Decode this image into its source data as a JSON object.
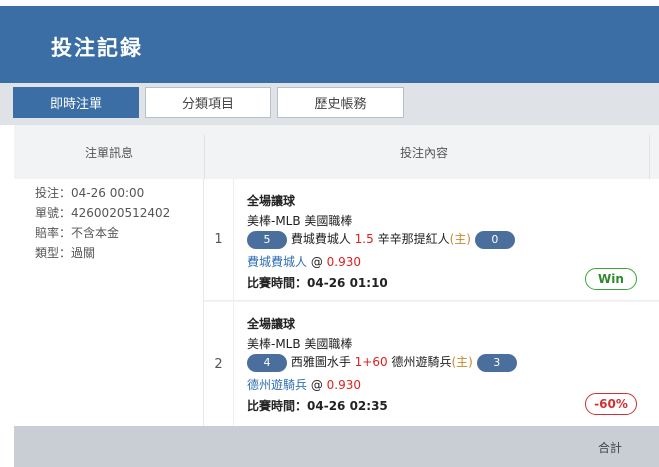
{
  "header": {
    "title": "投注記録"
  },
  "tabs": [
    {
      "label": "即時注單",
      "active": true
    },
    {
      "label": "分類項目",
      "active": false
    },
    {
      "label": "歷史帳務",
      "active": false
    }
  ],
  "table": {
    "col_info": "注單訊息",
    "col_content": "投注內容"
  },
  "bet_info": {
    "time_label": "投注：",
    "time_value": "04-26 00:00",
    "id_label": "單號：",
    "id_value": "4260020512402",
    "odds_label": "賠率：",
    "odds_value": "不含本金",
    "type_label": "類型：",
    "type_value": "過關"
  },
  "rows": [
    {
      "num": "1",
      "market": "全場讓球",
      "league": "美棒-MLB 美國職棒",
      "home_score": "5",
      "home_team": "費城費城人",
      "handicap": "1.5",
      "away_team": "辛辛那提紅人",
      "home_tag": "(主)",
      "away_score": "0",
      "pick": "費城費城人",
      "at": "@",
      "odds": "0.930",
      "match_time_label": "比賽時間：",
      "match_time": "04-26 01:10",
      "result": "Win"
    },
    {
      "num": "2",
      "market": "全場讓球",
      "league": "美棒-MLB 美國職棒",
      "home_score": "4",
      "home_team": "西雅圖水手",
      "handicap": "1+60",
      "away_team": "德州遊騎兵",
      "home_tag": "(主)",
      "away_score": "3",
      "pick": "德州遊騎兵",
      "at": "@",
      "odds": "0.930",
      "match_time_label": "比賽時間：",
      "match_time": "04-26 02:35",
      "result": "-60%"
    }
  ],
  "footer": {
    "total_label": "合計"
  },
  "colors": {
    "brand": "#3a6ea5",
    "win": "#2f8a2f",
    "loss": "#d23030",
    "handicap": "#e02020",
    "home_tag": "#c8892a"
  }
}
